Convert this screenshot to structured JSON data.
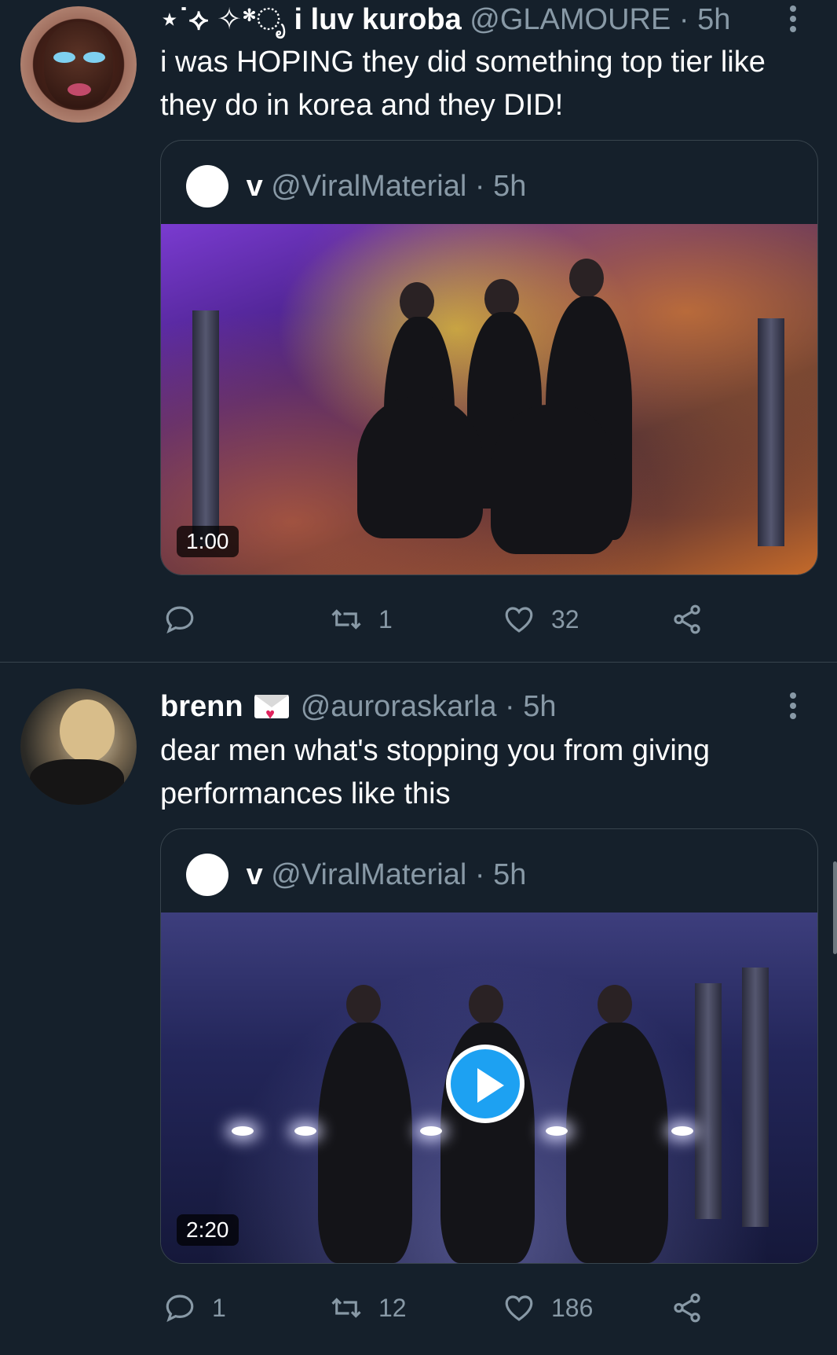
{
  "tweets": [
    {
      "display_name": "⋆˙⟡ ✧*ೃ i luv kuroba",
      "handle": "@GLAMOURE",
      "separator": "·",
      "time": "5h",
      "text": "i was HOPING they did something top tier like they do in korea and they DID!",
      "quote": {
        "name": "v",
        "handle": "@ViralMaterial",
        "separator": "·",
        "time": "5h",
        "video_duration": "1:00"
      },
      "actions": {
        "replies": "",
        "retweets": "1",
        "likes": "32"
      }
    },
    {
      "display_name": "brenn",
      "handle": "@auroraskarla",
      "separator": "·",
      "time": "5h",
      "text": "dear men what's stopping you from giving performances like this",
      "quote": {
        "name": "v",
        "handle": "@ViralMaterial",
        "separator": "·",
        "time": "5h",
        "video_duration": "2:20"
      },
      "actions": {
        "replies": "1",
        "retweets": "12",
        "likes": "186"
      }
    }
  ],
  "icons": {
    "reply": "reply-icon",
    "retweet": "retweet-icon",
    "like": "heart-icon",
    "share": "share-icon",
    "more": "more-options-icon",
    "envelope_emoji": "love-letter-icon",
    "play": "play-icon"
  },
  "colors": {
    "background": "#15202b",
    "secondary_text": "#8899a6",
    "border": "#38444d",
    "accent": "#1da1f2"
  }
}
